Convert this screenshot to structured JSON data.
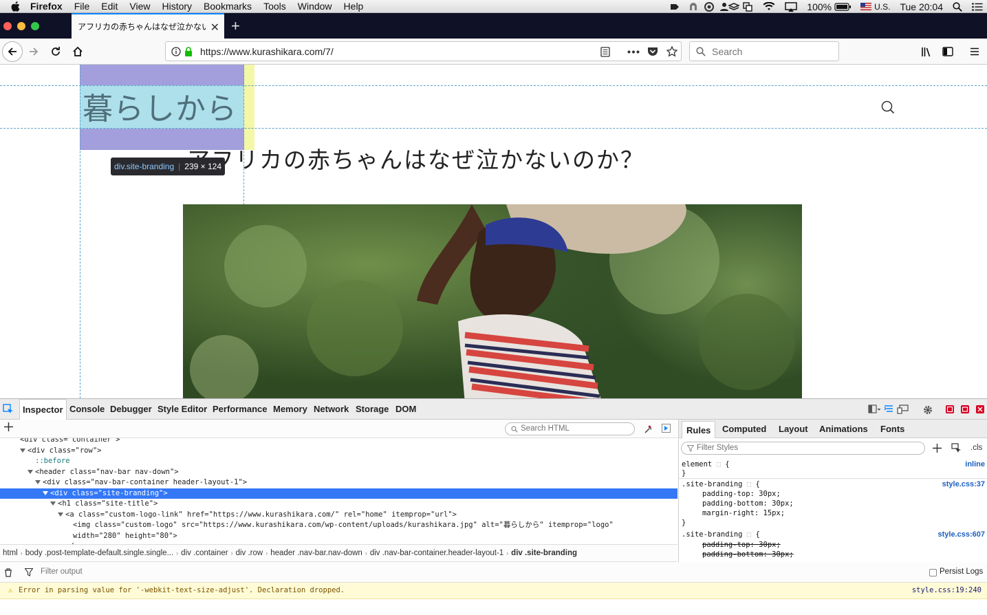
{
  "menubar": {
    "app": "Firefox",
    "items": [
      "File",
      "Edit",
      "View",
      "History",
      "Bookmarks",
      "Tools",
      "Window",
      "Help"
    ],
    "battery": "100%",
    "input_source": "U.S.",
    "clock": "Tue 20:04"
  },
  "tab": {
    "title": "アフリカの赤ちゃんはなぜ泣かないの",
    "close": "✕",
    "new_tab": "+"
  },
  "navbar": {
    "url": "https://www.kurashikara.com/7/",
    "search_placeholder": "Search"
  },
  "page": {
    "logo": "暮らしから",
    "post_title": "アフリカの赤ちゃんはなぜ泣かないのか？",
    "tooltip_selector": "div.site-branding",
    "tooltip_size": "239 × 124"
  },
  "devtools": {
    "tabs": [
      "Inspector",
      "Console",
      "Debugger",
      "Style Editor",
      "Performance",
      "Memory",
      "Network",
      "Storage",
      "DOM"
    ],
    "search_html_placeholder": "Search HTML",
    "markup": [
      {
        "indent": 0,
        "html": "<div class=\"container\">",
        "partial": true
      },
      {
        "indent": 1,
        "html": "<div class=\"row\">"
      },
      {
        "indent": 2,
        "html": "::before"
      },
      {
        "indent": 2,
        "html": "<header class=\"nav-bar nav-down\">"
      },
      {
        "indent": 3,
        "html": "<div class=\"nav-bar-container header-layout-1\">"
      },
      {
        "indent": 4,
        "html": "<div class=\"site-branding\">",
        "selected": true
      },
      {
        "indent": 5,
        "html": "<h1 class=\"site-title\">"
      },
      {
        "indent": 6,
        "html": "<a class=\"custom-logo-link\" href=\"https://www.kurashikara.com/\" rel=\"home\" itemprop=\"url\">"
      },
      {
        "indent": 7,
        "html": "<img class=\"custom-logo\" src=\"https://www.kurashikara.com/wp-content/uploads/kurashikara.jpg\" alt=\"暮らしから\" itemprop=\"logo\""
      },
      {
        "indent": 7,
        "html": "width=\"280\" height=\"80\">"
      },
      {
        "indent": 6,
        "html": "</a>",
        "partial": true
      }
    ],
    "breadcrumbs": [
      "html",
      "body .post-template-default.single.single...",
      "div .container",
      "div .row",
      "header .nav-bar.nav-down",
      "div .nav-bar-container.header-layout-1",
      "div .site-branding"
    ],
    "rules_tabs": [
      "Rules",
      "Computed",
      "Layout",
      "Animations",
      "Fonts"
    ],
    "filter_styles_placeholder": "Filter Styles",
    "cls_label": ".cls",
    "rules": {
      "element_selector": "element",
      "element_source": "inline",
      "rule1_selector": ".site-branding",
      "rule1_source": "style.css:37",
      "rule1_props": [
        "padding-top: 30px;",
        "padding-bottom: 30px;",
        "margin-right: 15px;"
      ],
      "rule2_selector": ".site-branding",
      "rule2_source": "style.css:607",
      "rule2_props": [
        "padding-top: 30px;",
        "padding-bottom: 30px;"
      ]
    },
    "console": {
      "filter_placeholder": "Filter output",
      "persist_logs": "Persist Logs",
      "message": "Error in parsing value for '-webkit-text-size-adjust'.  Declaration dropped.",
      "message_source": "style.css:19:240"
    }
  },
  "colors": {
    "selection": "#3478f6",
    "highlight_margin": "#a29fdc",
    "highlight_content": "#aee0ec",
    "tab_accent": "#0a84ff"
  }
}
